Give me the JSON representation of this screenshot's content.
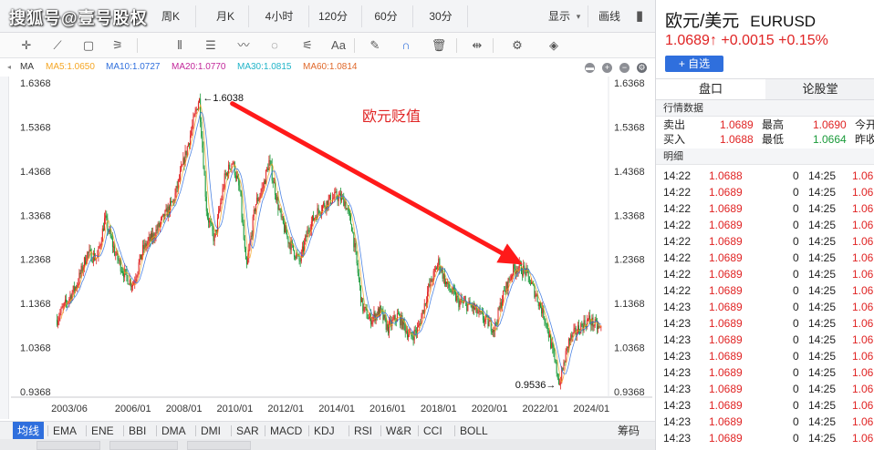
{
  "watermark": "搜狐号@壹号股权",
  "topbar": {
    "tabs": [
      "周K",
      "月K",
      "4小时",
      "120分",
      "60分",
      "30分"
    ],
    "display_label": "显示",
    "draw_label": "画线"
  },
  "toolbar": {
    "tools": [
      "crosshair-icon",
      "line-segment-icon",
      "rectangle-icon",
      "fan-icon",
      "parallel-lines-icon",
      "text-lines-icon",
      "wave-icon",
      "circle-icon",
      "fibonacci-icon",
      "text-tool-icon",
      "pen-icon",
      "magnet-icon",
      "trash-icon",
      "zoom-icon",
      "settings-icon",
      "layers-icon"
    ],
    "tool_glyphs": [
      "✛",
      "⟋",
      "▢",
      "⚞",
      "⦀",
      "☰",
      "〰",
      "◌",
      "⚟",
      "Aa",
      "✎",
      "∩",
      "🗑",
      "⇹",
      "⚙",
      "◈"
    ]
  },
  "ma_bar": {
    "label": "MA",
    "items": [
      {
        "text": "MA5:1.0650",
        "color": "#f5a623"
      },
      {
        "text": "MA10:1.0727",
        "color": "#2f6fdd"
      },
      {
        "text": "MA20:1.0770",
        "color": "#c2279a"
      },
      {
        "text": "MA30:1.0815",
        "color": "#20b4c8"
      },
      {
        "text": "MA60:1.0814",
        "color": "#e0682a"
      }
    ]
  },
  "chart_data": {
    "type": "line",
    "y_ticks": [
      "1.6368",
      "1.5368",
      "1.4368",
      "1.3368",
      "1.2368",
      "1.1368",
      "1.0368",
      "0.9368"
    ],
    "y_tick_values": [
      1.6368,
      1.5368,
      1.4368,
      1.3368,
      1.2368,
      1.1368,
      1.0368,
      0.9368
    ],
    "ylim": [
      0.9368,
      1.6368
    ],
    "x_ticks": [
      "2003/06",
      "2006/01",
      "2008/01",
      "2010/01",
      "2012/01",
      "2014/01",
      "2016/01",
      "2018/01",
      "2020/01",
      "2022/01",
      "2024/01"
    ],
    "x_tick_values": [
      2003.5,
      2006.0,
      2008.0,
      2010.0,
      2012.0,
      2014.0,
      2016.0,
      2018.0,
      2020.0,
      2022.0,
      2024.0
    ],
    "xlim": [
      2003.0,
      2024.6
    ],
    "series": [
      {
        "x": [
          2003.0,
          2003.4,
          2003.8,
          2004.2,
          2004.6,
          2004.9,
          2005.3,
          2005.7,
          2006.0,
          2006.4,
          2006.8,
          2007.2,
          2007.6,
          2008.0,
          2008.3,
          2008.6,
          2008.9,
          2009.2,
          2009.6,
          2009.9,
          2010.2,
          2010.45,
          2010.8,
          2011.1,
          2011.35,
          2011.8,
          2012.1,
          2012.55,
          2012.9,
          2013.3,
          2013.7,
          2014.0,
          2014.3,
          2014.6,
          2015.0,
          2015.3,
          2015.7,
          2016.0,
          2016.4,
          2016.9,
          2017.2,
          2017.6,
          2018.0,
          2018.3,
          2018.8,
          2019.3,
          2019.8,
          2020.2,
          2020.5,
          2020.9,
          2021.1,
          2021.4,
          2021.8,
          2022.2,
          2022.5,
          2022.75,
          2023.1,
          2023.5,
          2023.9,
          2024.3,
          2024.5
        ],
        "y": [
          1.1,
          1.14,
          1.18,
          1.25,
          1.24,
          1.33,
          1.25,
          1.2,
          1.18,
          1.26,
          1.29,
          1.33,
          1.37,
          1.46,
          1.53,
          1.6038,
          1.34,
          1.28,
          1.42,
          1.46,
          1.39,
          1.21,
          1.36,
          1.4,
          1.46,
          1.33,
          1.28,
          1.23,
          1.31,
          1.35,
          1.37,
          1.38,
          1.37,
          1.31,
          1.13,
          1.1,
          1.12,
          1.08,
          1.11,
          1.06,
          1.08,
          1.17,
          1.23,
          1.18,
          1.14,
          1.13,
          1.1,
          1.08,
          1.15,
          1.21,
          1.22,
          1.21,
          1.16,
          1.1,
          1.02,
          0.9536,
          1.05,
          1.08,
          1.1,
          1.08,
          1.08
        ]
      }
    ],
    "annotations": {
      "high_label": "←1.6038",
      "high_value": 1.6038,
      "high_x": 2008.6,
      "low_label": "0.9536→",
      "low_value": 0.9536,
      "low_x": 2022.75,
      "title_text": "欧元贬值",
      "arrow_from": [
        2009.9,
        1.59
      ],
      "arrow_to": [
        2021.3,
        1.225
      ]
    },
    "colors": {
      "up": "#e02424",
      "down": "#1a9a3a",
      "ma5": "#f5a623",
      "ma10": "#2f6fdd",
      "arrow": "#ff1a1a"
    }
  },
  "indicators": {
    "active": "均线",
    "items": [
      "EMA",
      "ENE",
      "BBI",
      "DMA",
      "DMI",
      "SAR",
      "MACD",
      "KDJ",
      "RSI",
      "W&R",
      "CCI",
      "BOLL"
    ],
    "right": "筹码"
  },
  "right_panel": {
    "name": "欧元/美元",
    "code": "EURUSD",
    "price": "1.0689↑",
    "change": "+0.0015",
    "change_pct": "+0.15%",
    "add_watch": "+ 自选",
    "tabs": [
      "盘口",
      "论股堂"
    ],
    "quote_header": "行情数据",
    "quote_rows": [
      {
        "l1": "卖出",
        "v1": "1.0689",
        "l2": "最高",
        "v2": "1.0690",
        "c2": "red",
        "l3": "今开"
      },
      {
        "l1": "买入",
        "v1": "1.0688",
        "l2": "最低",
        "v2": "1.0664",
        "c2": "green",
        "l3": "昨收"
      }
    ],
    "detail_header": "明细",
    "ticks": [
      {
        "t": "14:22",
        "p": "1.0688",
        "v": "0",
        "t2": "14:25",
        "p2": "1.06"
      },
      {
        "t": "14:22",
        "p": "1.0689",
        "v": "0",
        "t2": "14:25",
        "p2": "1.06"
      },
      {
        "t": "14:22",
        "p": "1.0689",
        "v": "0",
        "t2": "14:25",
        "p2": "1.06"
      },
      {
        "t": "14:22",
        "p": "1.0689",
        "v": "0",
        "t2": "14:25",
        "p2": "1.06"
      },
      {
        "t": "14:22",
        "p": "1.0689",
        "v": "0",
        "t2": "14:25",
        "p2": "1.06"
      },
      {
        "t": "14:22",
        "p": "1.0689",
        "v": "0",
        "t2": "14:25",
        "p2": "1.06"
      },
      {
        "t": "14:22",
        "p": "1.0689",
        "v": "0",
        "t2": "14:25",
        "p2": "1.06"
      },
      {
        "t": "14:22",
        "p": "1.0689",
        "v": "0",
        "t2": "14:25",
        "p2": "1.06"
      },
      {
        "t": "14:23",
        "p": "1.0689",
        "v": "0",
        "t2": "14:25",
        "p2": "1.06"
      },
      {
        "t": "14:23",
        "p": "1.0689",
        "v": "0",
        "t2": "14:25",
        "p2": "1.06"
      },
      {
        "t": "14:23",
        "p": "1.0689",
        "v": "0",
        "t2": "14:25",
        "p2": "1.06"
      },
      {
        "t": "14:23",
        "p": "1.0689",
        "v": "0",
        "t2": "14:25",
        "p2": "1.06"
      },
      {
        "t": "14:23",
        "p": "1.0689",
        "v": "0",
        "t2": "14:25",
        "p2": "1.06"
      },
      {
        "t": "14:23",
        "p": "1.0689",
        "v": "0",
        "t2": "14:25",
        "p2": "1.06"
      },
      {
        "t": "14:23",
        "p": "1.0689",
        "v": "0",
        "t2": "14:25",
        "p2": "1.06"
      },
      {
        "t": "14:23",
        "p": "1.0689",
        "v": "0",
        "t2": "14:25",
        "p2": "1.06"
      },
      {
        "t": "14:23",
        "p": "1.0689",
        "v": "0",
        "t2": "14:25",
        "p2": "1.06"
      }
    ]
  }
}
